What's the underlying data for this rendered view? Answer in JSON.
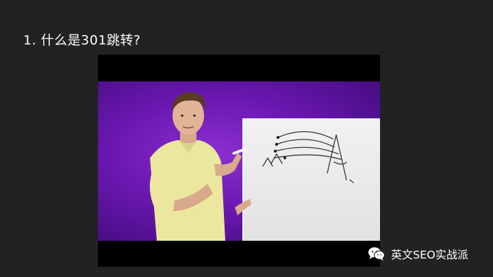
{
  "slide": {
    "title": "1. 什么是301跳转?"
  },
  "video": {
    "background_color": "#6a18b0",
    "whiteboard_color": "#ececec"
  },
  "watermark": {
    "icon": "wechat-icon",
    "text": "英文SEO实战派"
  }
}
